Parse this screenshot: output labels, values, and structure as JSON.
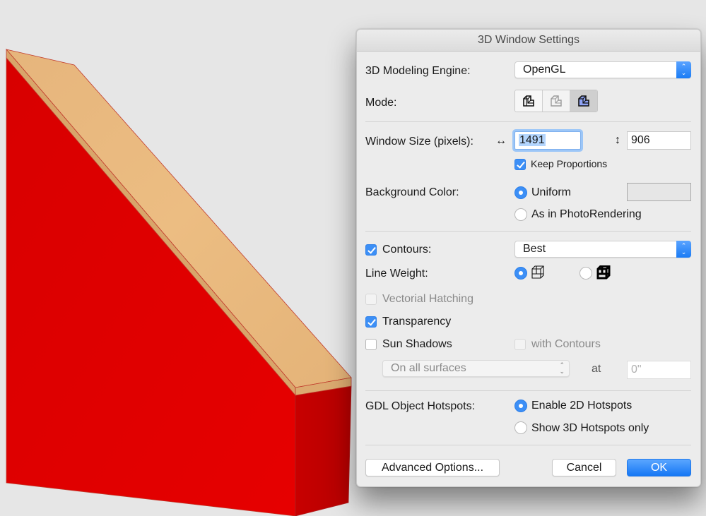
{
  "viewport": {
    "description": "3D view of red wall with wooden top slab",
    "colors": {
      "wall_front": "#e00000",
      "wall_side": "#c20000",
      "wood_top": "#e8b77a",
      "wood_edge": "#d6a468",
      "contour": "#c0392b",
      "background": "#e6e6e6"
    }
  },
  "dialog": {
    "title": "3D Window Settings",
    "engine": {
      "label": "3D Modeling Engine:",
      "value": "OpenGL"
    },
    "mode": {
      "label": "Mode:",
      "options": [
        {
          "name": "wireframe",
          "icon": "wireframe-mode-icon",
          "selected": false
        },
        {
          "name": "hidden-line",
          "icon": "hidden-line-mode-icon",
          "selected": false
        },
        {
          "name": "shading",
          "icon": "shading-mode-icon",
          "selected": true
        }
      ]
    },
    "window_size": {
      "label": "Window Size (pixels):",
      "width_icon": "↔",
      "width": "1491",
      "height_icon": "↕",
      "height": "906",
      "keep_proportions_label": "Keep Proportions",
      "keep_proportions": true
    },
    "background": {
      "label": "Background Color:",
      "options": [
        {
          "label": "Uniform",
          "selected": true
        },
        {
          "label": "As in PhotoRendering",
          "selected": false
        }
      ],
      "swatch_color": "#e6e6e6"
    },
    "contours": {
      "label": "Contours:",
      "checked": true,
      "value": "Best"
    },
    "line_weight": {
      "label": "Line Weight:",
      "options": [
        {
          "name": "thin",
          "icon": "thin-line-cube-icon",
          "selected": true
        },
        {
          "name": "thick",
          "icon": "thick-line-cube-icon",
          "selected": false
        }
      ]
    },
    "vectorial_hatching": {
      "label": "Vectorial Hatching",
      "checked": false,
      "disabled": true
    },
    "transparency": {
      "label": "Transparency",
      "checked": true
    },
    "sun_shadows": {
      "label": "Sun Shadows",
      "checked": false,
      "with_contours_label": "with Contours",
      "with_contours": false,
      "surfaces_value": "On all surfaces",
      "at_label": "at",
      "at_value": "0\""
    },
    "gdl_hotspots": {
      "label": "GDL Object Hotspots:",
      "options": [
        {
          "label": "Enable 2D Hotspots",
          "selected": true
        },
        {
          "label": "Show 3D Hotspots only",
          "selected": false
        }
      ]
    },
    "buttons": {
      "advanced": "Advanced Options...",
      "cancel": "Cancel",
      "ok": "OK"
    },
    "accent_color": "#3c8ff6"
  }
}
